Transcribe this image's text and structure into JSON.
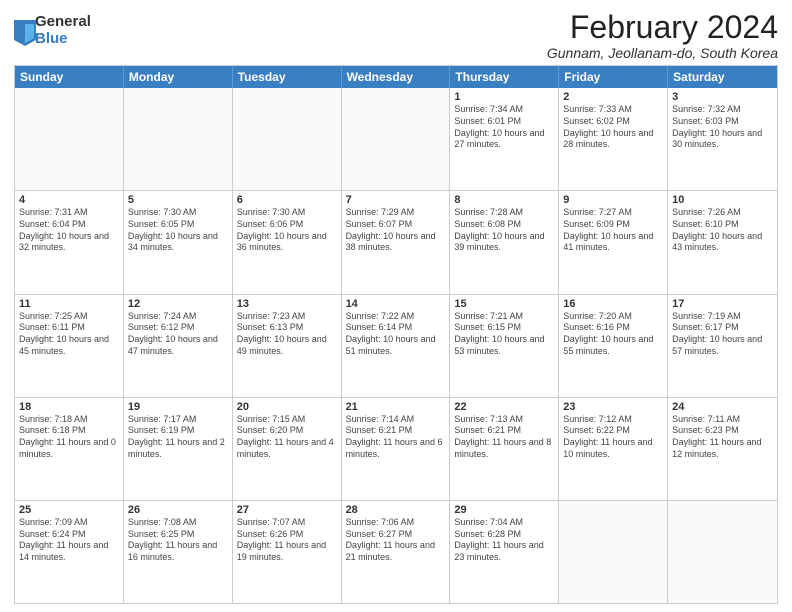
{
  "logo": {
    "general": "General",
    "blue": "Blue"
  },
  "title": "February 2024",
  "location": "Gunnam, Jeollanam-do, South Korea",
  "days_of_week": [
    "Sunday",
    "Monday",
    "Tuesday",
    "Wednesday",
    "Thursday",
    "Friday",
    "Saturday"
  ],
  "weeks": [
    [
      {
        "day": "",
        "text": ""
      },
      {
        "day": "",
        "text": ""
      },
      {
        "day": "",
        "text": ""
      },
      {
        "day": "",
        "text": ""
      },
      {
        "day": "1",
        "text": "Sunrise: 7:34 AM\nSunset: 6:01 PM\nDaylight: 10 hours and 27 minutes."
      },
      {
        "day": "2",
        "text": "Sunrise: 7:33 AM\nSunset: 6:02 PM\nDaylight: 10 hours and 28 minutes."
      },
      {
        "day": "3",
        "text": "Sunrise: 7:32 AM\nSunset: 6:03 PM\nDaylight: 10 hours and 30 minutes."
      }
    ],
    [
      {
        "day": "4",
        "text": "Sunrise: 7:31 AM\nSunset: 6:04 PM\nDaylight: 10 hours and 32 minutes."
      },
      {
        "day": "5",
        "text": "Sunrise: 7:30 AM\nSunset: 6:05 PM\nDaylight: 10 hours and 34 minutes."
      },
      {
        "day": "6",
        "text": "Sunrise: 7:30 AM\nSunset: 6:06 PM\nDaylight: 10 hours and 36 minutes."
      },
      {
        "day": "7",
        "text": "Sunrise: 7:29 AM\nSunset: 6:07 PM\nDaylight: 10 hours and 38 minutes."
      },
      {
        "day": "8",
        "text": "Sunrise: 7:28 AM\nSunset: 6:08 PM\nDaylight: 10 hours and 39 minutes."
      },
      {
        "day": "9",
        "text": "Sunrise: 7:27 AM\nSunset: 6:09 PM\nDaylight: 10 hours and 41 minutes."
      },
      {
        "day": "10",
        "text": "Sunrise: 7:26 AM\nSunset: 6:10 PM\nDaylight: 10 hours and 43 minutes."
      }
    ],
    [
      {
        "day": "11",
        "text": "Sunrise: 7:25 AM\nSunset: 6:11 PM\nDaylight: 10 hours and 45 minutes."
      },
      {
        "day": "12",
        "text": "Sunrise: 7:24 AM\nSunset: 6:12 PM\nDaylight: 10 hours and 47 minutes."
      },
      {
        "day": "13",
        "text": "Sunrise: 7:23 AM\nSunset: 6:13 PM\nDaylight: 10 hours and 49 minutes."
      },
      {
        "day": "14",
        "text": "Sunrise: 7:22 AM\nSunset: 6:14 PM\nDaylight: 10 hours and 51 minutes."
      },
      {
        "day": "15",
        "text": "Sunrise: 7:21 AM\nSunset: 6:15 PM\nDaylight: 10 hours and 53 minutes."
      },
      {
        "day": "16",
        "text": "Sunrise: 7:20 AM\nSunset: 6:16 PM\nDaylight: 10 hours and 55 minutes."
      },
      {
        "day": "17",
        "text": "Sunrise: 7:19 AM\nSunset: 6:17 PM\nDaylight: 10 hours and 57 minutes."
      }
    ],
    [
      {
        "day": "18",
        "text": "Sunrise: 7:18 AM\nSunset: 6:18 PM\nDaylight: 11 hours and 0 minutes."
      },
      {
        "day": "19",
        "text": "Sunrise: 7:17 AM\nSunset: 6:19 PM\nDaylight: 11 hours and 2 minutes."
      },
      {
        "day": "20",
        "text": "Sunrise: 7:15 AM\nSunset: 6:20 PM\nDaylight: 11 hours and 4 minutes."
      },
      {
        "day": "21",
        "text": "Sunrise: 7:14 AM\nSunset: 6:21 PM\nDaylight: 11 hours and 6 minutes."
      },
      {
        "day": "22",
        "text": "Sunrise: 7:13 AM\nSunset: 6:21 PM\nDaylight: 11 hours and 8 minutes."
      },
      {
        "day": "23",
        "text": "Sunrise: 7:12 AM\nSunset: 6:22 PM\nDaylight: 11 hours and 10 minutes."
      },
      {
        "day": "24",
        "text": "Sunrise: 7:11 AM\nSunset: 6:23 PM\nDaylight: 11 hours and 12 minutes."
      }
    ],
    [
      {
        "day": "25",
        "text": "Sunrise: 7:09 AM\nSunset: 6:24 PM\nDaylight: 11 hours and 14 minutes."
      },
      {
        "day": "26",
        "text": "Sunrise: 7:08 AM\nSunset: 6:25 PM\nDaylight: 11 hours and 16 minutes."
      },
      {
        "day": "27",
        "text": "Sunrise: 7:07 AM\nSunset: 6:26 PM\nDaylight: 11 hours and 19 minutes."
      },
      {
        "day": "28",
        "text": "Sunrise: 7:06 AM\nSunset: 6:27 PM\nDaylight: 11 hours and 21 minutes."
      },
      {
        "day": "29",
        "text": "Sunrise: 7:04 AM\nSunset: 6:28 PM\nDaylight: 11 hours and 23 minutes."
      },
      {
        "day": "",
        "text": ""
      },
      {
        "day": "",
        "text": ""
      }
    ]
  ]
}
